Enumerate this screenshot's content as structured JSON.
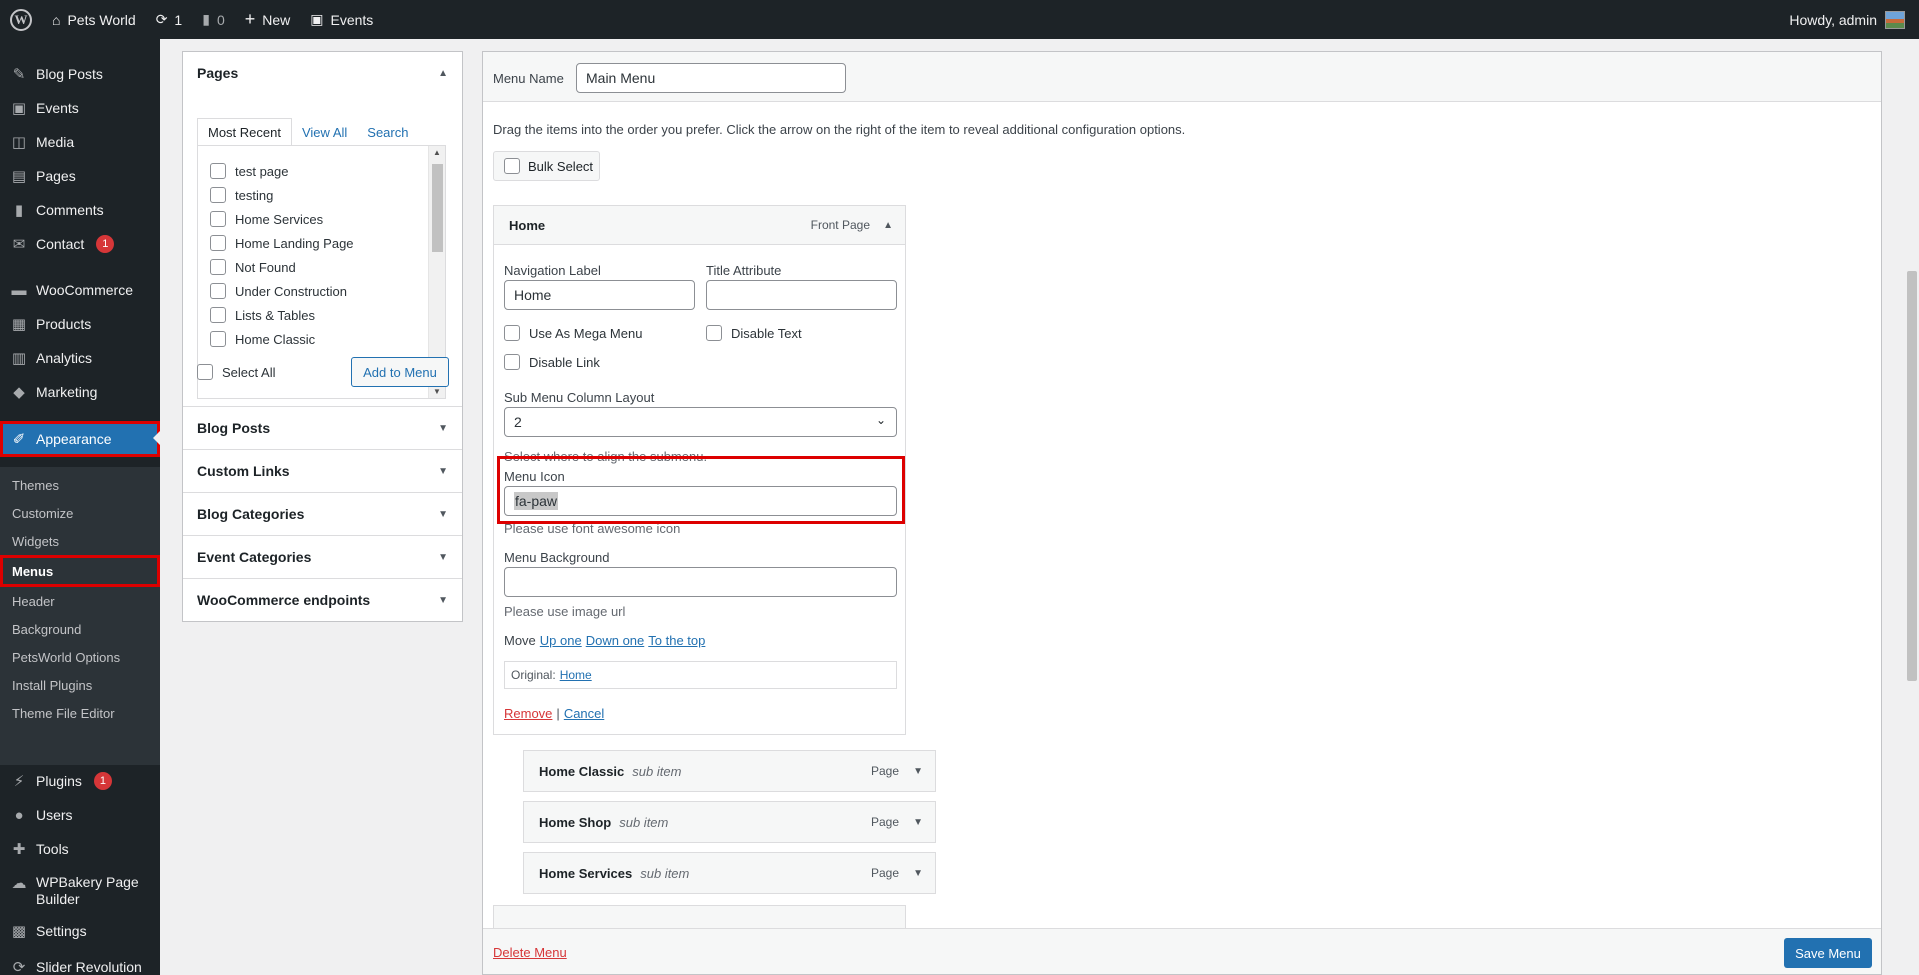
{
  "adminbar": {
    "site_name": "Pets World",
    "updates_count": "1",
    "comments_count": "0",
    "new_label": "New",
    "events_label": "Events",
    "howdy": "Howdy, admin"
  },
  "sidebar": {
    "items": [
      {
        "label": "Blog Posts",
        "icon": "pin-icon"
      },
      {
        "label": "Events",
        "icon": "events-icon"
      },
      {
        "label": "Media",
        "icon": "media-icon"
      },
      {
        "label": "Pages",
        "icon": "pages-icon"
      },
      {
        "label": "Comments",
        "icon": "comments-icon"
      },
      {
        "label": "Contact",
        "icon": "mail-icon",
        "badge": "1"
      },
      {
        "label": "WooCommerce",
        "icon": "woo-icon"
      },
      {
        "label": "Products",
        "icon": "products-icon"
      },
      {
        "label": "Analytics",
        "icon": "analytics-icon"
      },
      {
        "label": "Marketing",
        "icon": "megaphone-icon"
      },
      {
        "label": "Appearance",
        "icon": "brush-icon"
      },
      {
        "label": "Plugins",
        "icon": "plugins-icon",
        "badge": "1"
      },
      {
        "label": "Users",
        "icon": "users-icon"
      },
      {
        "label": "Tools",
        "icon": "tools-icon"
      },
      {
        "label": "WPBakery Page",
        "label2": "Builder",
        "icon": "wpbakery-icon"
      },
      {
        "label": "Settings",
        "icon": "settings-icon"
      },
      {
        "label": "Slider Revolution",
        "icon": "slider-icon"
      }
    ],
    "submenu": [
      "Themes",
      "Customize",
      "Widgets",
      "Menus",
      "Header",
      "Background",
      "PetsWorld Options",
      "Install Plugins",
      "Theme File Editor"
    ]
  },
  "pages_panel": {
    "title": "Pages",
    "tabs": [
      "Most Recent",
      "View All",
      "Search"
    ],
    "pages": [
      "test page",
      "testing",
      "Home Services",
      "Home Landing Page",
      "Not Found",
      "Under Construction",
      "Lists & Tables",
      "Home Classic"
    ],
    "select_all": "Select All",
    "add_button": "Add to Menu",
    "sections": [
      "Blog Posts",
      "Custom Links",
      "Blog Categories",
      "Event Categories",
      "WooCommerce endpoints"
    ]
  },
  "editor": {
    "menu_name_label": "Menu Name",
    "menu_name_value": "Main Menu",
    "instructions": "Drag the items into the order you prefer. Click the arrow on the right of the item to reveal additional configuration options.",
    "bulk_select": "Bulk Select",
    "item": {
      "title": "Home",
      "type": "Front Page",
      "nav_label_label": "Navigation Label",
      "nav_label_value": "Home",
      "title_attr_label": "Title Attribute",
      "title_attr_value": "",
      "mega_menu": "Use As Mega Menu",
      "disable_text": "Disable Text",
      "disable_link": "Disable Link",
      "submenu_layout_label": "Sub Menu Column Layout",
      "submenu_layout_value": "2",
      "submenu_hint": "Select where to align the submenu.",
      "menu_icon_label": "Menu Icon",
      "menu_icon_value": "fa-paw",
      "menu_icon_hint": "Please use font awesome icon",
      "menu_bg_label": "Menu Background",
      "menu_bg_value": "",
      "menu_bg_hint": "Please use image url",
      "move_label": "Move",
      "move_up": "Up one",
      "move_down": "Down one",
      "move_top": "To the top",
      "original_label": "Original:",
      "original_link": "Home",
      "remove": "Remove",
      "separator": "|",
      "cancel": "Cancel"
    },
    "sub_items": [
      {
        "title": "Home Classic",
        "note": "sub item",
        "type": "Page"
      },
      {
        "title": "Home Shop",
        "note": "sub item",
        "type": "Page"
      },
      {
        "title": "Home Services",
        "note": "sub item",
        "type": "Page"
      }
    ],
    "delete_menu": "Delete Menu",
    "save_menu": "Save Menu"
  }
}
